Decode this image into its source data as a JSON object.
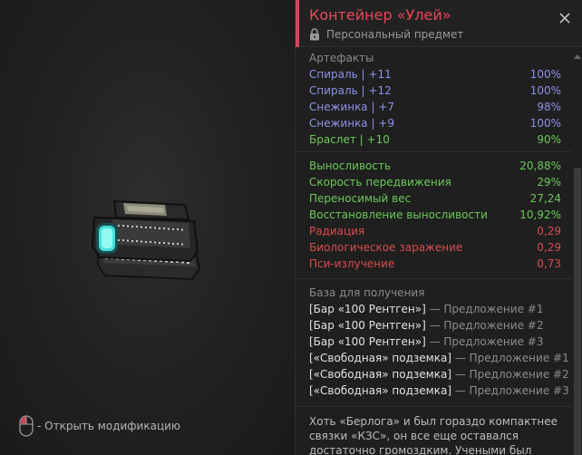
{
  "item": {
    "title": "Контейнер «Улей»",
    "subtitle": "Персональный предмет",
    "lock_icon": "lock-icon",
    "close_icon": "close-icon"
  },
  "hint": {
    "icon": "mouse-icon",
    "text": "- Открыть модификацию"
  },
  "artifacts": {
    "title": "Артефакты",
    "items": [
      {
        "name": "Спираль | +11",
        "value": "100%",
        "color": "#8a93e8"
      },
      {
        "name": "Спираль | +12",
        "value": "100%",
        "color": "#8a93e8"
      },
      {
        "name": "Снежинка | +7",
        "value": "98%",
        "color": "#8a93e8"
      },
      {
        "name": "Снежинка | +9",
        "value": "100%",
        "color": "#8a93e8"
      },
      {
        "name": "Браслет | +10",
        "value": "90%",
        "color": "#6cc85a"
      }
    ]
  },
  "stats": [
    {
      "name": "Выносливость",
      "value": "20,88%",
      "color": "#6cc85a"
    },
    {
      "name": "Скорость передвижения",
      "value": "29%",
      "color": "#6cc85a"
    },
    {
      "name": "Переносимый вес",
      "value": "27,24",
      "color": "#6cc85a"
    },
    {
      "name": "Восстановление выносливости",
      "value": "10,92%",
      "color": "#6cc85a"
    },
    {
      "name": "Радиация",
      "value": "0,29",
      "color": "#d94d4d"
    },
    {
      "name": "Биологическое заражение",
      "value": "0,29",
      "color": "#d94d4d"
    },
    {
      "name": "Пси-излучение",
      "value": "0,73",
      "color": "#d94d4d"
    }
  ],
  "base": {
    "title": "База для получения",
    "items": [
      {
        "place": "[Бар «100 Рентген»]",
        "offer": " — Предложение #1"
      },
      {
        "place": "[Бар «100 Рентген»]",
        "offer": " — Предложение #2"
      },
      {
        "place": "[Бар «100 Рентген»]",
        "offer": " — Предложение #3"
      },
      {
        "place": "[«Свободная» подземка]",
        "offer": " — Предложение #1"
      },
      {
        "place": "[«Свободная» подземка]",
        "offer": " — Предложение #2"
      },
      {
        "place": "[«Свободная» подземка]",
        "offer": " — Предложение #3"
      }
    ]
  },
  "description": "Хоть «Берлога» и был гораздо компактнее связки «КЗС», он все еще оставался достаточно громоздким. Учеными был"
}
